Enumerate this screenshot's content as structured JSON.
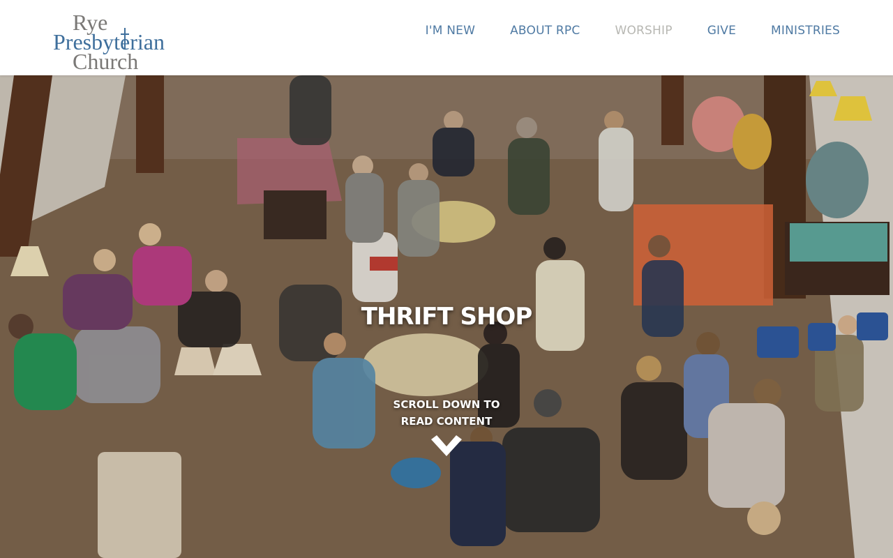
{
  "site": {
    "logo": {
      "line1": "Rye",
      "line2": "Presbyterian",
      "line3": "Church"
    }
  },
  "nav": {
    "items": [
      {
        "label": "I'M NEW",
        "active": false
      },
      {
        "label": "ABOUT RPC",
        "active": false
      },
      {
        "label": "WORSHIP",
        "active": true
      },
      {
        "label": "GIVE",
        "active": false
      },
      {
        "label": "MINISTRIES",
        "active": false
      }
    ]
  },
  "hero": {
    "title": "THRIFT SHOP",
    "scroll_hint_line1": "SCROLL DOWN TO",
    "scroll_hint_line2": "READ CONTENT",
    "scroll_icon": "chevron-down-icon"
  },
  "colors": {
    "brand_blue": "#3f6f9c",
    "nav_blue": "#4f7aa3",
    "nav_active": "#b7b7b2",
    "logo_gray": "#7a7876"
  }
}
